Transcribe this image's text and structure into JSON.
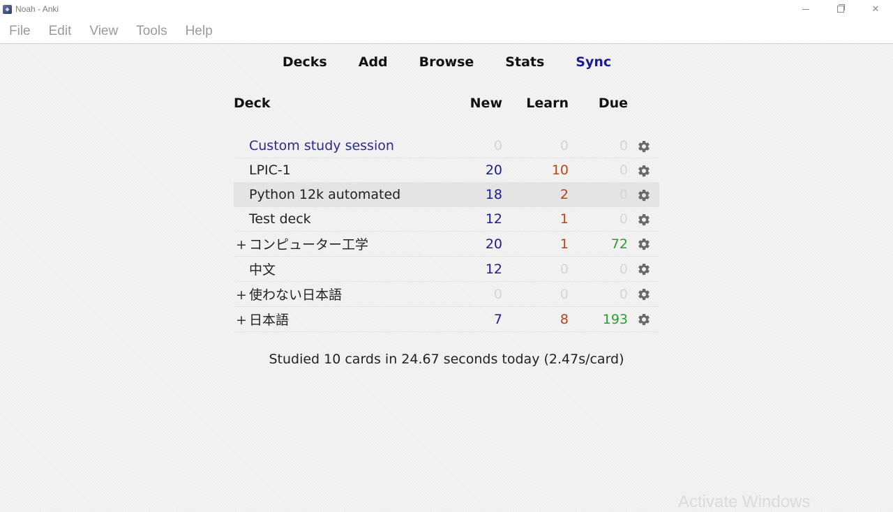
{
  "window": {
    "title": "Noah - Anki",
    "controls": [
      "minimize",
      "maximize",
      "close"
    ]
  },
  "menu": [
    "File",
    "Edit",
    "View",
    "Tools",
    "Help"
  ],
  "toplinks": [
    "Decks",
    "Add",
    "Browse",
    "Stats",
    "Sync"
  ],
  "table": {
    "headers": {
      "deck": "Deck",
      "new": "New",
      "learn": "Learn",
      "due": "Due"
    },
    "rows": [
      {
        "expander": "",
        "name": "Custom study session",
        "new": "0",
        "learn": "0",
        "due": "0",
        "filtered": true,
        "current": false
      },
      {
        "expander": "",
        "name": "LPIC-1",
        "new": "20",
        "learn": "10",
        "due": "0",
        "filtered": false,
        "current": false
      },
      {
        "expander": "",
        "name": "Python 12k automated",
        "new": "18",
        "learn": "2",
        "due": "0",
        "filtered": false,
        "current": true
      },
      {
        "expander": "",
        "name": "Test deck",
        "new": "12",
        "learn": "1",
        "due": "0",
        "filtered": false,
        "current": false
      },
      {
        "expander": "+",
        "name": "コンピューター工学",
        "new": "20",
        "learn": "1",
        "due": "72",
        "filtered": false,
        "current": false
      },
      {
        "expander": "",
        "name": "中文",
        "new": "12",
        "learn": "0",
        "due": "0",
        "filtered": false,
        "current": false
      },
      {
        "expander": "+",
        "name": "使わない日本語",
        "new": "0",
        "learn": "0",
        "due": "0",
        "filtered": false,
        "current": false
      },
      {
        "expander": "+",
        "name": "日本語",
        "new": "7",
        "learn": "8",
        "due": "193",
        "filtered": false,
        "current": false
      }
    ]
  },
  "summary": "Studied 10 cards in 24.67 seconds today (2.47s/card)",
  "watermark": "Activate Windows",
  "colors": {
    "new": "#1c1c8f",
    "learn": "#b54416",
    "due": "#2f9a2f",
    "zero": "#d6d6d6",
    "sync_link": "#1c1c8f"
  }
}
